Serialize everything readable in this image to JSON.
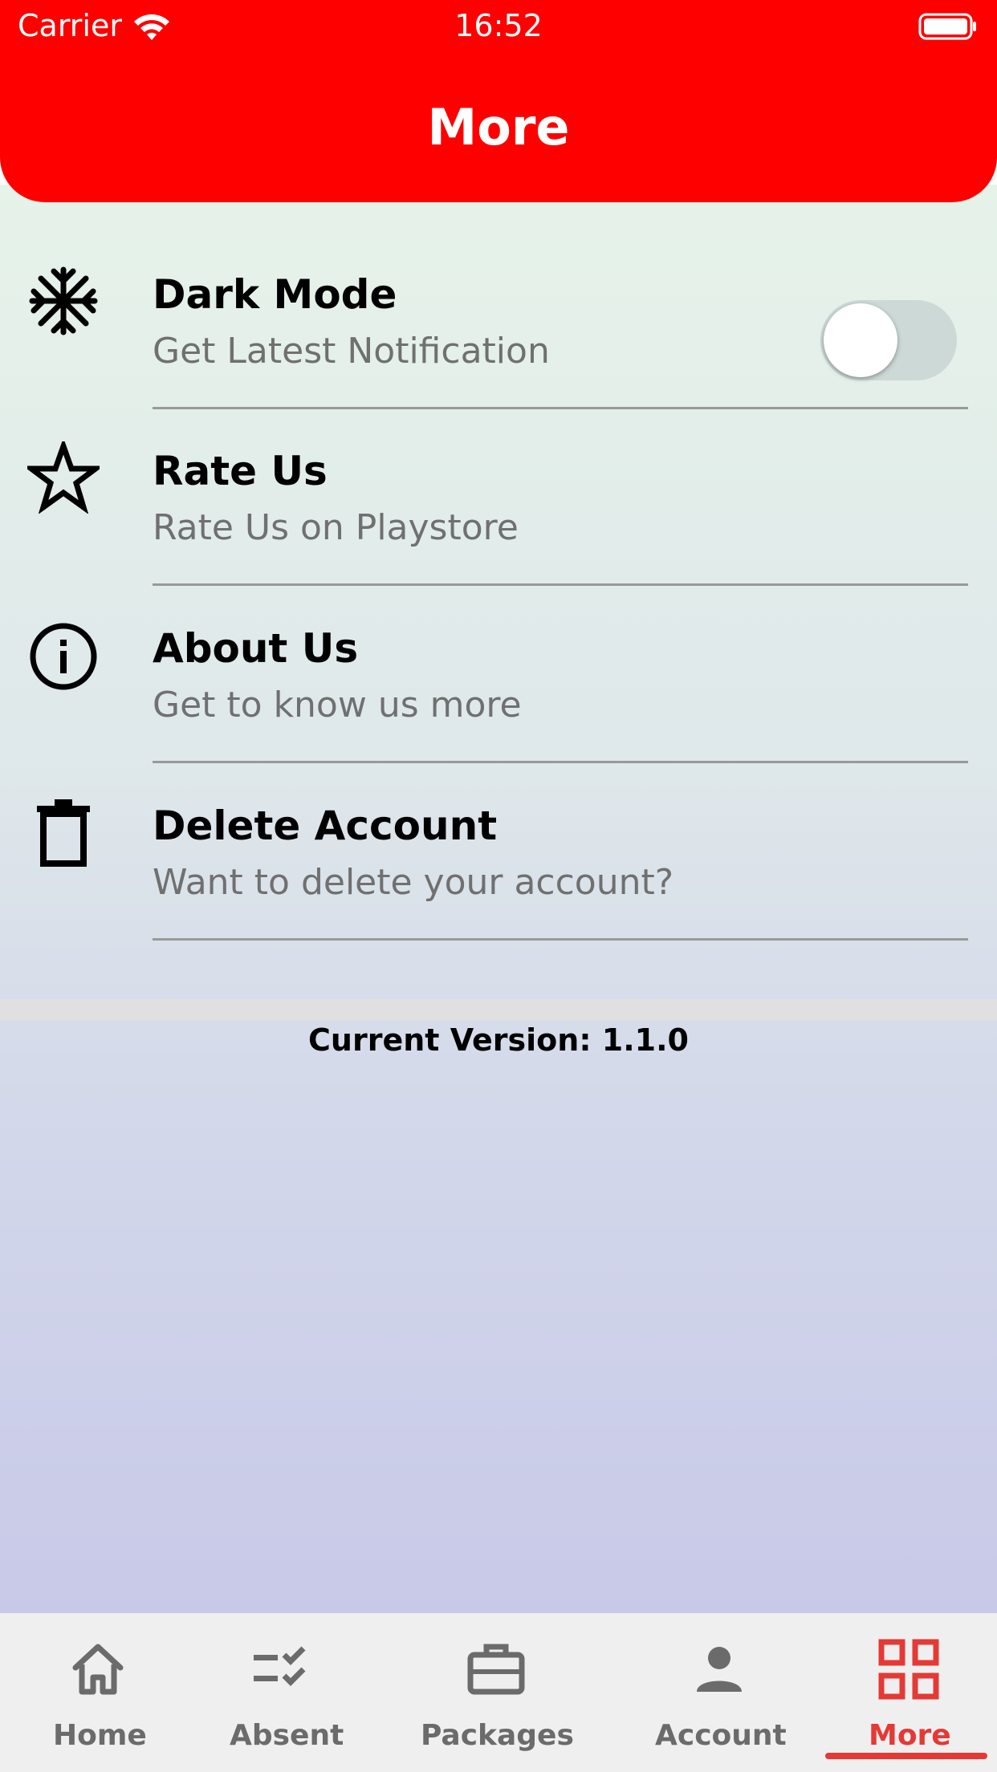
{
  "status_bar": {
    "carrier": "Carrier",
    "time": "16:52"
  },
  "header": {
    "title": "More"
  },
  "settings": {
    "items": [
      {
        "title": "Dark Mode",
        "subtitle": "Get Latest Notification",
        "icon": "snowflake-icon",
        "toggle_on": false
      },
      {
        "title": "Rate Us",
        "subtitle": "Rate Us on Playstore",
        "icon": "star-icon"
      },
      {
        "title": "About Us",
        "subtitle": "Get to know us more",
        "icon": "info-icon"
      },
      {
        "title": "Delete Account",
        "subtitle": "Want to delete your account?",
        "icon": "trash-icon"
      }
    ]
  },
  "version": {
    "text": "Current Version: 1.1.0"
  },
  "bottom_nav": {
    "active": "More",
    "items": [
      {
        "label": "Home",
        "icon": "home-icon"
      },
      {
        "label": "Absent",
        "icon": "checklist-icon"
      },
      {
        "label": "Packages",
        "icon": "briefcase-icon"
      },
      {
        "label": "Account",
        "icon": "person-icon"
      },
      {
        "label": "More",
        "icon": "grid-icon"
      }
    ]
  },
  "colors": {
    "header_red": "#ff0000",
    "active_tab": "#e53935",
    "inactive_tab": "#6b6b6b"
  }
}
